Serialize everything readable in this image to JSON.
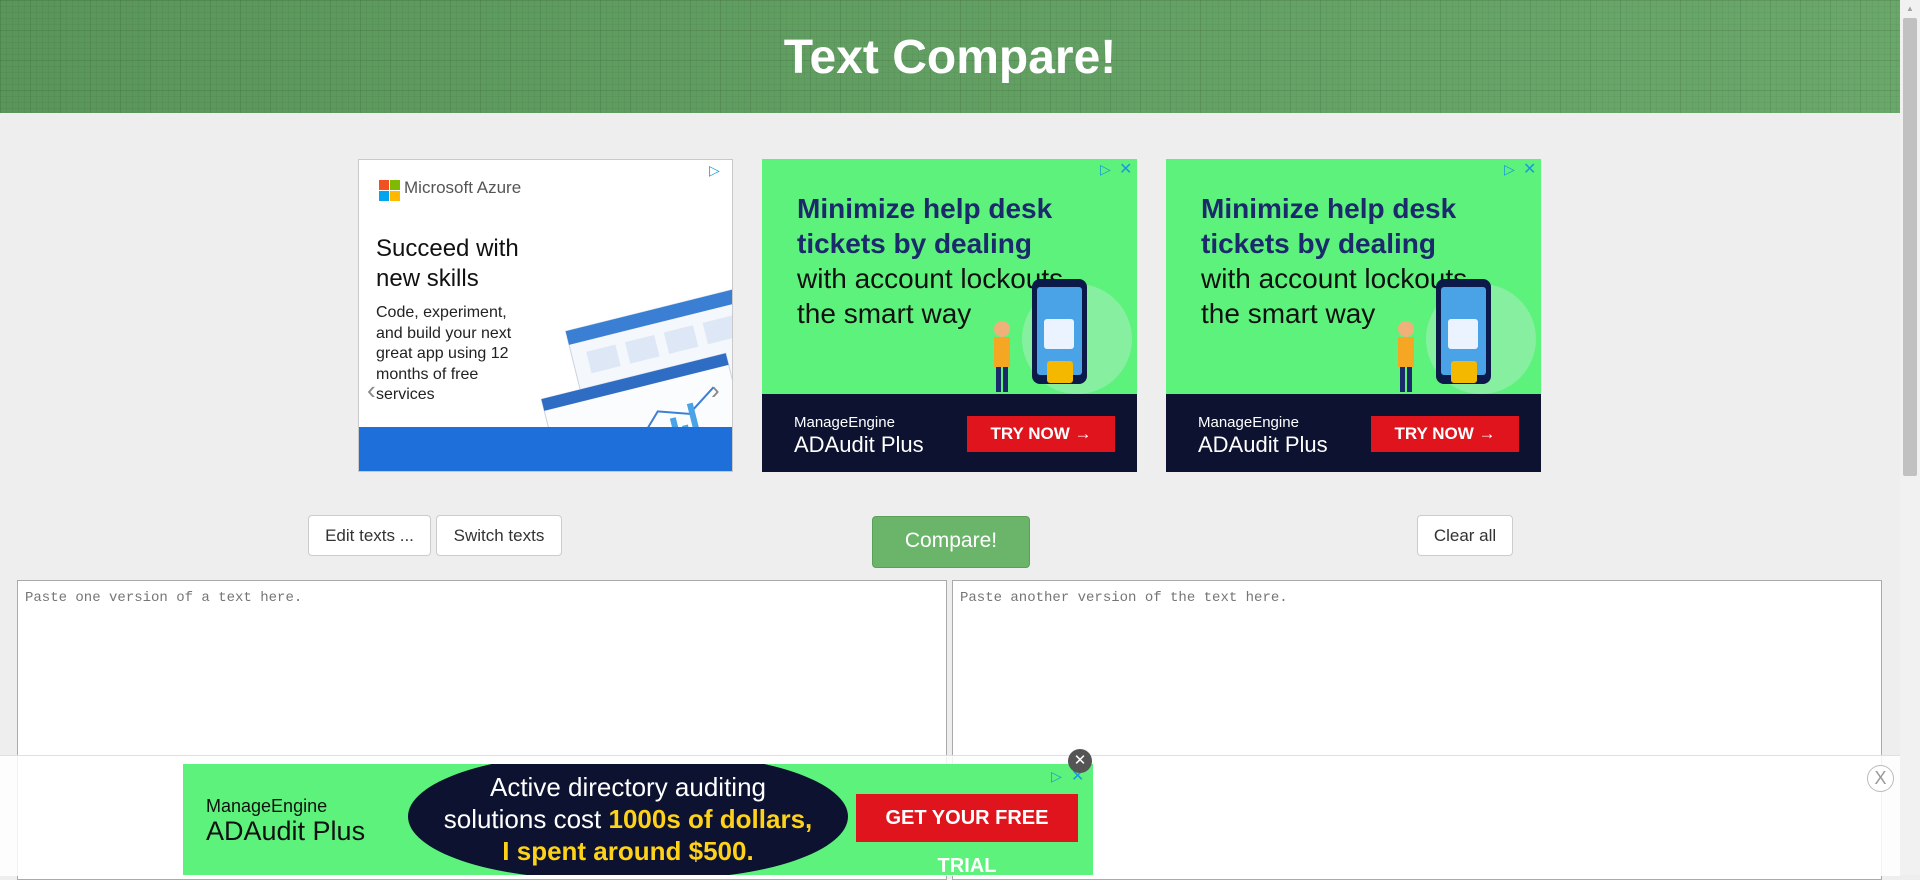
{
  "header": {
    "title": "Text Compare!",
    "background_color": "#5f9e5f"
  },
  "ads": {
    "azure": {
      "brand": "Microsoft Azure",
      "headline": "Succeed with new skills",
      "body": "Code, experiment, and build your next great app using 12 months of free services"
    },
    "manageengine_1": {
      "headline_bold": "Minimize help desk tickets by dealing",
      "headline_rest": "with account lockouts the smart way",
      "brand_top": "ManageEngine",
      "brand": "ADAudit Plus",
      "cta": "TRY NOW →"
    },
    "manageengine_2": {
      "headline_bold": "Minimize help desk tickets by dealing",
      "headline_rest": "with account lockouts the smart way",
      "brand_top": "ManageEngine",
      "brand": "ADAudit Plus",
      "cta": "TRY NOW →"
    },
    "bottom": {
      "brand_top": "ManageEngine",
      "brand": "ADAudit Plus",
      "line1": "Active directory auditing",
      "line2_prefix": "solutions cost",
      "line2_highlight": "1000s of dollars,",
      "line3": "I spent around $500.",
      "cta": "GET YOUR FREE TRIAL",
      "close_label": "X"
    }
  },
  "toolbar": {
    "edit_label": "Edit texts ...",
    "switch_label": "Switch texts",
    "compare_label": "Compare!",
    "clear_label": "Clear all"
  },
  "editors": {
    "left_placeholder": "Paste one version of a text here.",
    "right_placeholder": "Paste another version of the text here."
  },
  "colors": {
    "ad_green": "#5df27b",
    "ad_navy": "#0c1230",
    "cta_red": "#e0141c",
    "compare_green": "#6bb56b"
  }
}
